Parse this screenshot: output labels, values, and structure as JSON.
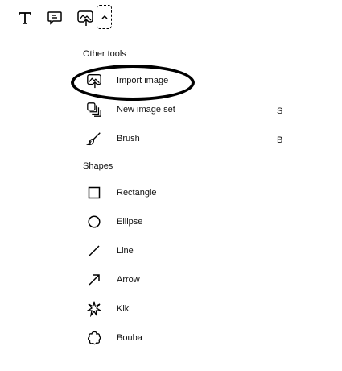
{
  "toolbar": {
    "tools": [
      {
        "name": "partial-tool-icon"
      },
      {
        "name": "text-tool-icon"
      },
      {
        "name": "note-tool-icon"
      },
      {
        "name": "import-image-tool-icon"
      },
      {
        "name": "chevron-up-icon"
      }
    ]
  },
  "menu": {
    "other_tools_label": "Other tools",
    "items_other": [
      {
        "label": "Import image",
        "icon": "import-image-icon",
        "shortcut": ""
      },
      {
        "label": "New image set",
        "icon": "image-set-icon",
        "shortcut": "S"
      },
      {
        "label": "Brush",
        "icon": "brush-icon",
        "shortcut": "B"
      }
    ],
    "shapes_label": "Shapes",
    "items_shapes": [
      {
        "label": "Rectangle",
        "icon": "rectangle-icon"
      },
      {
        "label": "Ellipse",
        "icon": "ellipse-icon"
      },
      {
        "label": "Line",
        "icon": "line-icon"
      },
      {
        "label": "Arrow",
        "icon": "arrow-icon"
      },
      {
        "label": "Kiki",
        "icon": "kiki-icon"
      },
      {
        "label": "Bouba",
        "icon": "bouba-icon"
      }
    ]
  }
}
